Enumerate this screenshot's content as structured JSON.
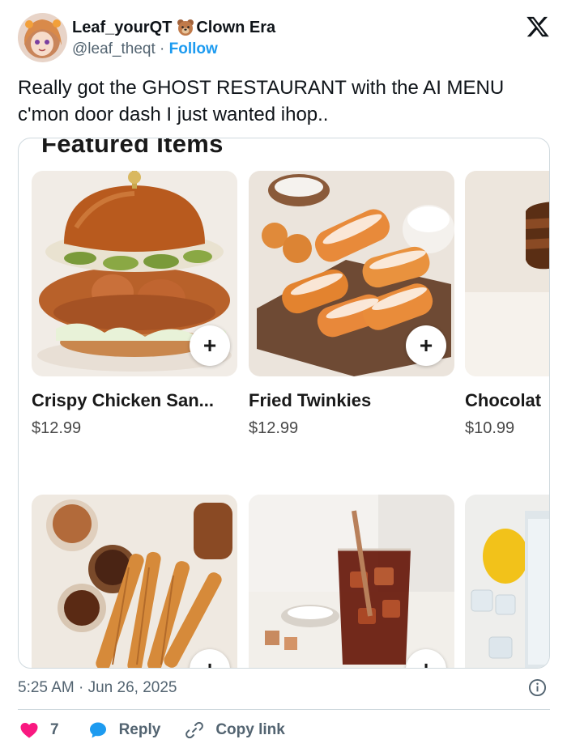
{
  "post": {
    "author_name": "Leaf_yourQT",
    "author_emoji_icon": "bear-face-icon",
    "author_name_suffix": "⁠Clown Era⁠",
    "handle": "@leaf_theqt",
    "separator": "·",
    "follow_label": "Follow",
    "platform_icon": "x-logo-icon",
    "text": "Really got the GHOST RESTAURANT with the AI MENU c'mon door dash I just wanted ihop..",
    "timestamp": "5:25 AM · Jun 26, 2025"
  },
  "media": {
    "section_title": "Featured Items",
    "items": [
      {
        "name": "Crispy Chicken San...",
        "price": "$12.99",
        "image": "crispy-chicken-sandwich"
      },
      {
        "name": "Fried Twinkies",
        "price": "$12.99",
        "image": "fried-twinkies"
      },
      {
        "name": "Chocolat",
        "price": "$10.99",
        "image": "chocolate-cake"
      },
      {
        "name": "",
        "price": "",
        "image": "churros"
      },
      {
        "name": "",
        "price": "",
        "image": "iced-cola"
      },
      {
        "name": "",
        "price": "",
        "image": "lemon-soda"
      }
    ],
    "add_label": "+"
  },
  "actions": {
    "like_count": "7",
    "reply_label": "Reply",
    "copy_label": "Copy link"
  },
  "colors": {
    "accent": "#1d9bf0",
    "like": "#f91880",
    "text": "#0f1419",
    "muted": "#536471"
  }
}
